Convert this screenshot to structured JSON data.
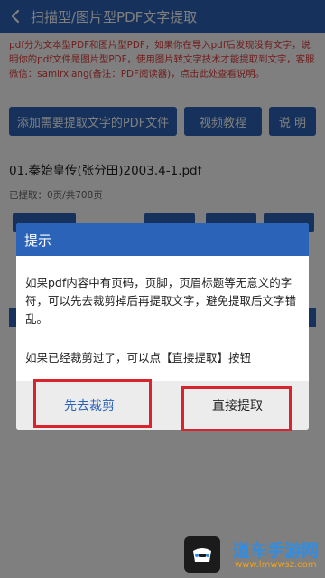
{
  "app_bar": {
    "title": "扫描型/图片型PDF文字提取"
  },
  "notice": {
    "text": "pdf分为文本型PDF和图片型PDF，如果你在导入pdf后发现没有文字，说明你的pdf文件是图片型PDF，使用图片转文字技术才能提取到文字，客服微信：samirxiang(备注：PDF阅读器)，点击此处查看说明。"
  },
  "buttons": {
    "add_pdf": "添加需要提取文字的PDF文件",
    "video_tutorial": "视频教程",
    "explain": "说 明"
  },
  "file": {
    "name": "01.秦始皇传(张分田)2003.4-1.pdf",
    "progress": "已提取：0页/共708页"
  },
  "dialog": {
    "title": "提示",
    "message1": "如果pdf内容中有页码，页脚，页眉标题等无意义的字符，可以先去裁剪掉后再提取文字，避免提取后文字错乱。",
    "message2": "如果已经裁剪过了，可以点【直接提取】按钮",
    "crop_button": "先去裁剪",
    "extract_button": "直接提取"
  },
  "watermark": {
    "title": "道车手游网",
    "domain": "www.lmwwsz.com"
  },
  "colors": {
    "primary": "#2a63b8",
    "notice_text": "#e23b3b",
    "highlight": "#d9232d",
    "dialog_footer": "#ececec"
  }
}
